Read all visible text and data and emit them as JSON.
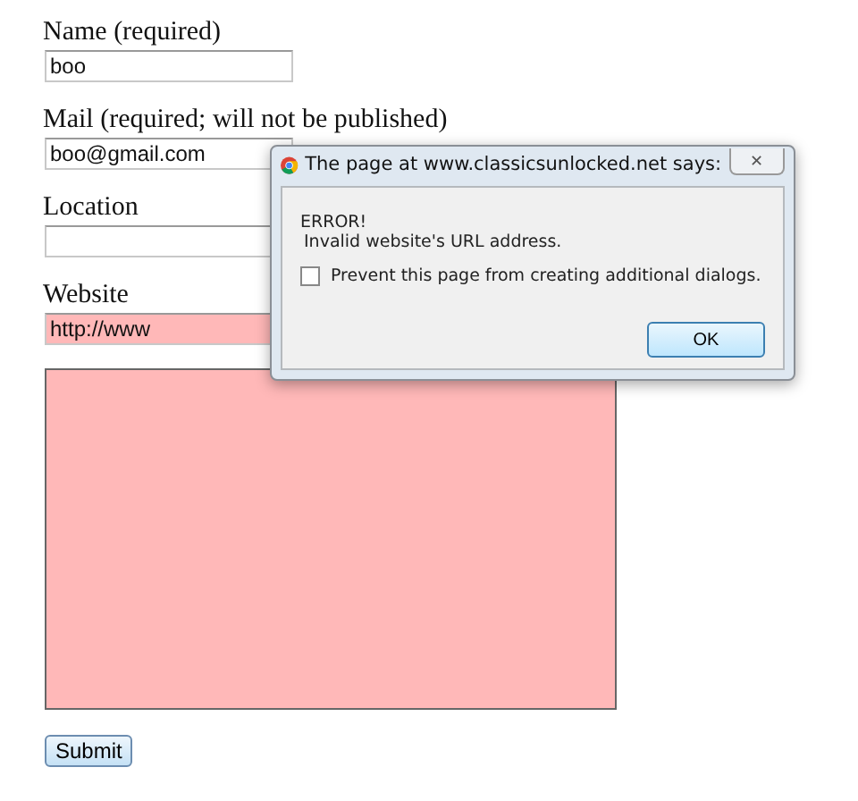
{
  "form": {
    "fields": [
      {
        "kind": "input",
        "label": "Name (required)",
        "value": "boo",
        "invalid": false
      },
      {
        "kind": "input",
        "label": "Mail (required; will not be published)",
        "value": "boo@gmail.com",
        "invalid": false
      },
      {
        "kind": "input",
        "label": "Location",
        "invalid": false
      },
      {
        "kind": "input",
        "label": "Website",
        "value": "http://www",
        "invalid": true
      },
      {
        "kind": "textarea",
        "invalid": true
      }
    ],
    "submit": "Submit"
  },
  "dialog": {
    "title": "The page at www.classicsunlocked.net says:",
    "close": "✕",
    "message_title": "ERROR!",
    "message": "Invalid website's URL address.",
    "checkbox": {
      "label": "Prevent this page from creating additional dialogs.",
      "checked": false
    },
    "ok": "OK"
  }
}
